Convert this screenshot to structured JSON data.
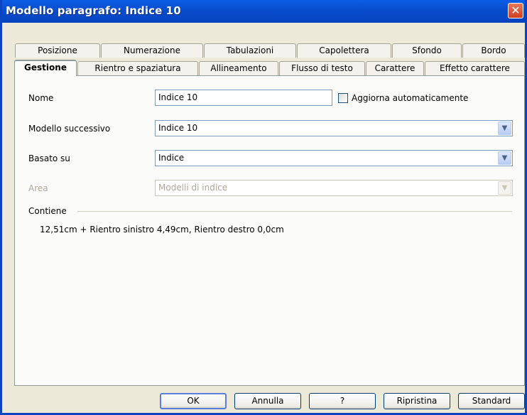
{
  "window": {
    "title": "Modello paragrafo: Indice 10",
    "close_glyph": "✕"
  },
  "tabs_row1": [
    "Posizione",
    "Numerazione",
    "Tabulazioni",
    "Capolettera",
    "Sfondo",
    "Bordo"
  ],
  "tabs_row2": [
    "Gestione",
    "Rientro e spaziatura",
    "Allineamento",
    "Flusso di testo",
    "Carattere",
    "Effetto carattere"
  ],
  "form": {
    "name_label": "Nome",
    "name_value": "Indice 10",
    "auto_update_label": "Aggiorna automaticamente",
    "auto_update_checked": false,
    "next_style_label": "Modello successivo",
    "next_style_value": "Indice 10",
    "based_on_label": "Basato su",
    "based_on_value": "Indice",
    "area_label": "Area",
    "area_value": "Modelli di indice",
    "dropdown_glyph": "▼"
  },
  "contains": {
    "label": "Contiene",
    "text": "12,51cm + Rientro sinistro  4,49cm, Rientro destro  0,0cm"
  },
  "buttons": {
    "ok": "OK",
    "cancel": "Annulla",
    "help": "?",
    "reset": "Ripristina",
    "standard": "Standard"
  }
}
